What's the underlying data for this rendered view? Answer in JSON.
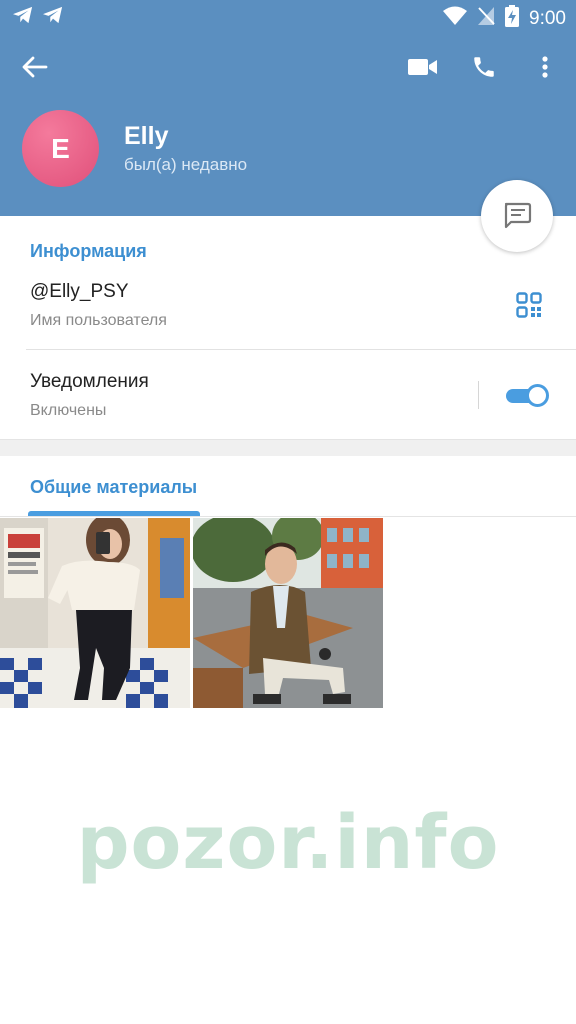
{
  "status_bar": {
    "time": "9:00"
  },
  "header": {
    "avatar_letter": "E",
    "name": "Elly",
    "last_seen": "был(а) недавно"
  },
  "info": {
    "section_title": "Информация",
    "username": "@Elly_PSY",
    "username_caption": "Имя пользователя",
    "notifications_label": "Уведомления",
    "notifications_state": "Включены",
    "notifications_on": true
  },
  "media": {
    "tab_label": "Общие материалы",
    "photos": [
      {
        "icon": "photo-woman-mirror-selfie"
      },
      {
        "icon": "photo-man-on-bench"
      }
    ]
  },
  "watermark": "pozor.info",
  "colors": {
    "header": "#5b8fc0",
    "accent": "#3d8fd1",
    "avatar": "#e85b84"
  }
}
